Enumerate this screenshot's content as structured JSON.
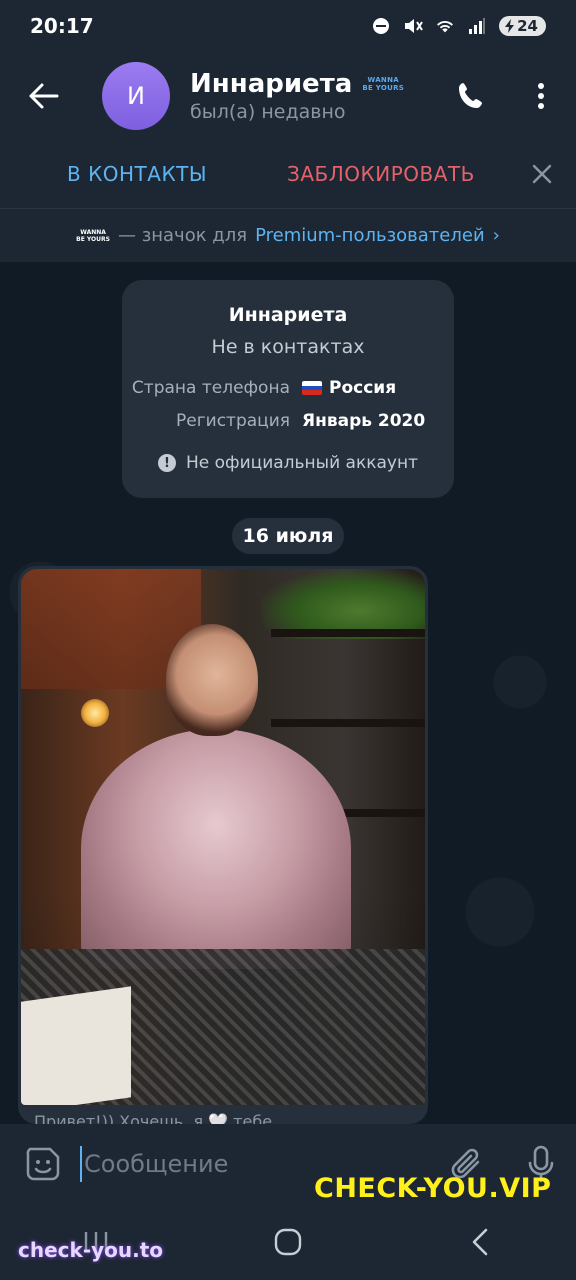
{
  "status_bar": {
    "time": "20:17",
    "battery": "24"
  },
  "header": {
    "avatar_letter": "И",
    "name": "Иннариета",
    "premium_badge_line1": "WANNA",
    "premium_badge_line2": "BE YOURS",
    "status": "был(а) недавно"
  },
  "action_bar": {
    "add_contact": "В КОНТАКТЫ",
    "block": "ЗАБЛОКИРОВАТЬ"
  },
  "premium_note": {
    "badge_line1": "WANNA",
    "badge_line2": "BE YOURS",
    "text": "— значок для",
    "link": "Premium-пользователей",
    "chevron": "›"
  },
  "info_card": {
    "name": "Иннариета",
    "subtitle": "Не в контактах",
    "phone_country_label": "Страна телефона",
    "phone_country_value": "Россия",
    "registration_label": "Регистрация",
    "registration_value": "Январь 2020",
    "warning": "Не официальный аккаунт"
  },
  "date_divider": "16 июля",
  "message": {
    "caption": "Привет!)) Хочешь, я 🤍 тебе..."
  },
  "input": {
    "placeholder": "Сообщение"
  },
  "watermarks": {
    "top": "CHECK-YOU.VIP",
    "bottom": "check-you.to"
  },
  "colors": {
    "accent": "#5db4f0",
    "danger": "#e5626a",
    "header_bg": "#1d2734",
    "card_bg": "#26303c",
    "avatar": "#8c6ee8"
  }
}
